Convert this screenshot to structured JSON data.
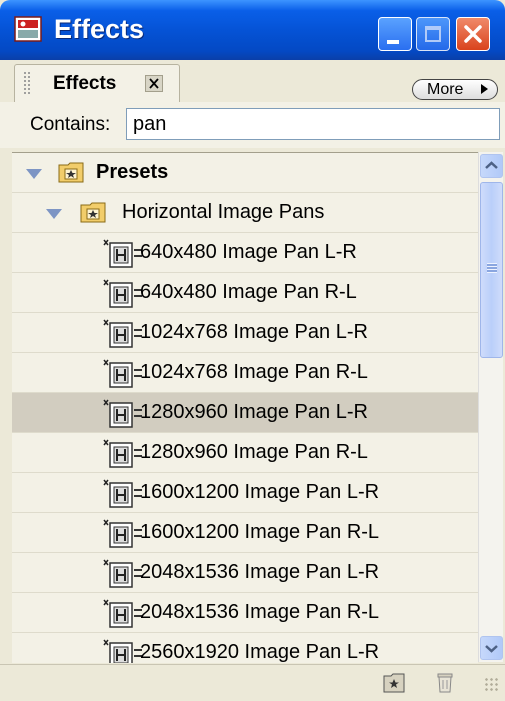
{
  "window": {
    "title": "Effects"
  },
  "tab": {
    "label": "Effects",
    "more_label": "More"
  },
  "search": {
    "label": "Contains:",
    "value": "pan"
  },
  "tree": {
    "root": {
      "label": "Presets"
    },
    "folder": {
      "label": "Horizontal Image Pans"
    },
    "items": [
      {
        "label": " 640x480 Image Pan L-R"
      },
      {
        "label": " 640x480 Image Pan R-L"
      },
      {
        "label": "1024x768 Image Pan L-R"
      },
      {
        "label": "1024x768 Image Pan R-L"
      },
      {
        "label": "1280x960 Image Pan L-R",
        "selected": true
      },
      {
        "label": "1280x960 Image Pan R-L"
      },
      {
        "label": "1600x1200 Image Pan L-R"
      },
      {
        "label": "1600x1200 Image Pan R-L"
      },
      {
        "label": "2048x1536 Image Pan L-R"
      },
      {
        "label": "2048x1536 Image Pan R-L"
      },
      {
        "label": "2560x1920 Image Pan L-R"
      }
    ]
  },
  "colors": {
    "titlebar": "#0553d6",
    "selection": "#D2CDC0",
    "panel": "#ECE9D8"
  },
  "icons": [
    "app-icon",
    "close-icon",
    "folder-icon",
    "preset-icon",
    "new-bin-icon",
    "trash-icon"
  ]
}
